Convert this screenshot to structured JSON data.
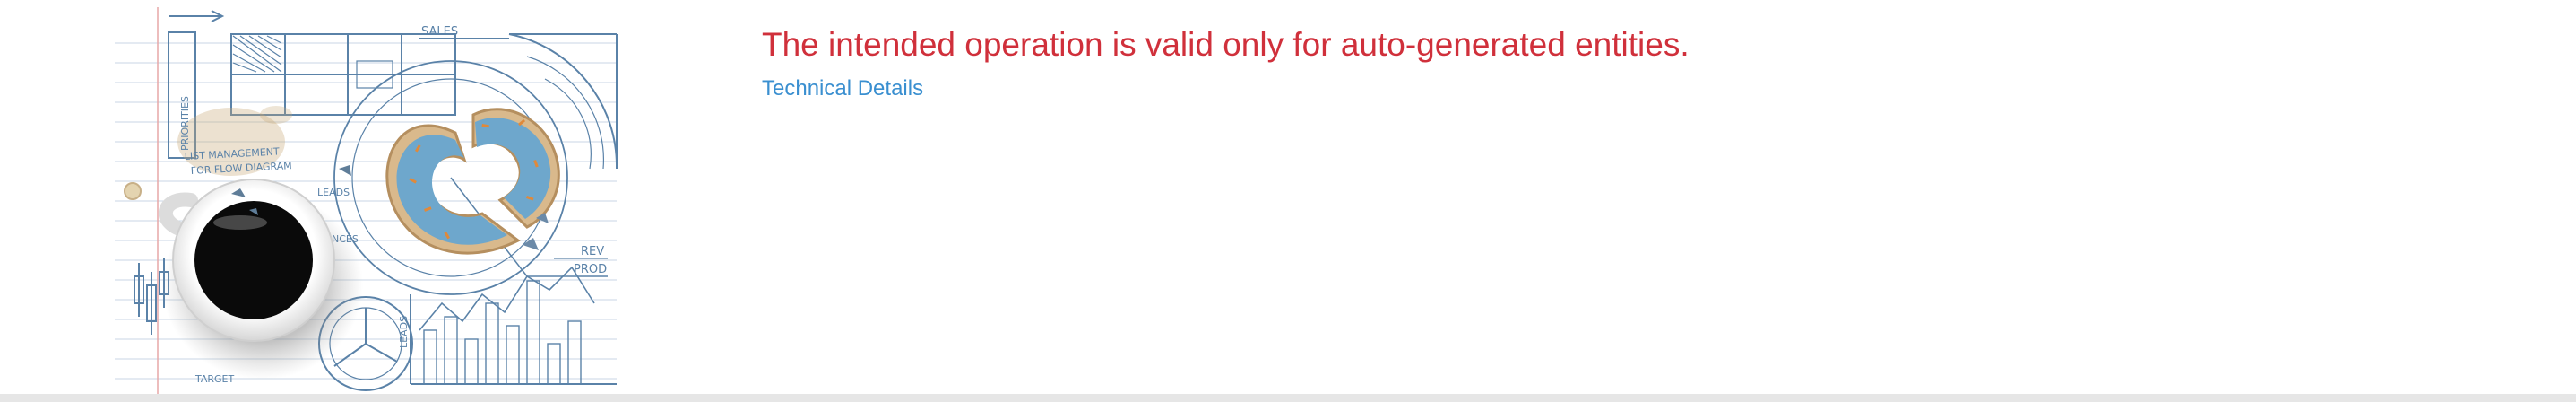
{
  "error": {
    "title": "The intended operation is valid only for auto-generated entities.",
    "details_link": "Technical Details"
  },
  "illustration": {
    "sketch_labels": {
      "sales": "SALES",
      "priorities": "PRIORITIES",
      "list": "LIST MANAGEMENT",
      "flow": "FOR FLOW DIAGRAM",
      "leads": "LEADS",
      "nces": "NCES",
      "rev": "REV",
      "prod": "PROD",
      "leads2": "LEADS",
      "target": "TARGET"
    }
  },
  "colors": {
    "error_text": "#d0303b",
    "link": "#3a8fd0",
    "sketch": "#5a82a8",
    "bottom_strip": "#e6e6e6"
  }
}
